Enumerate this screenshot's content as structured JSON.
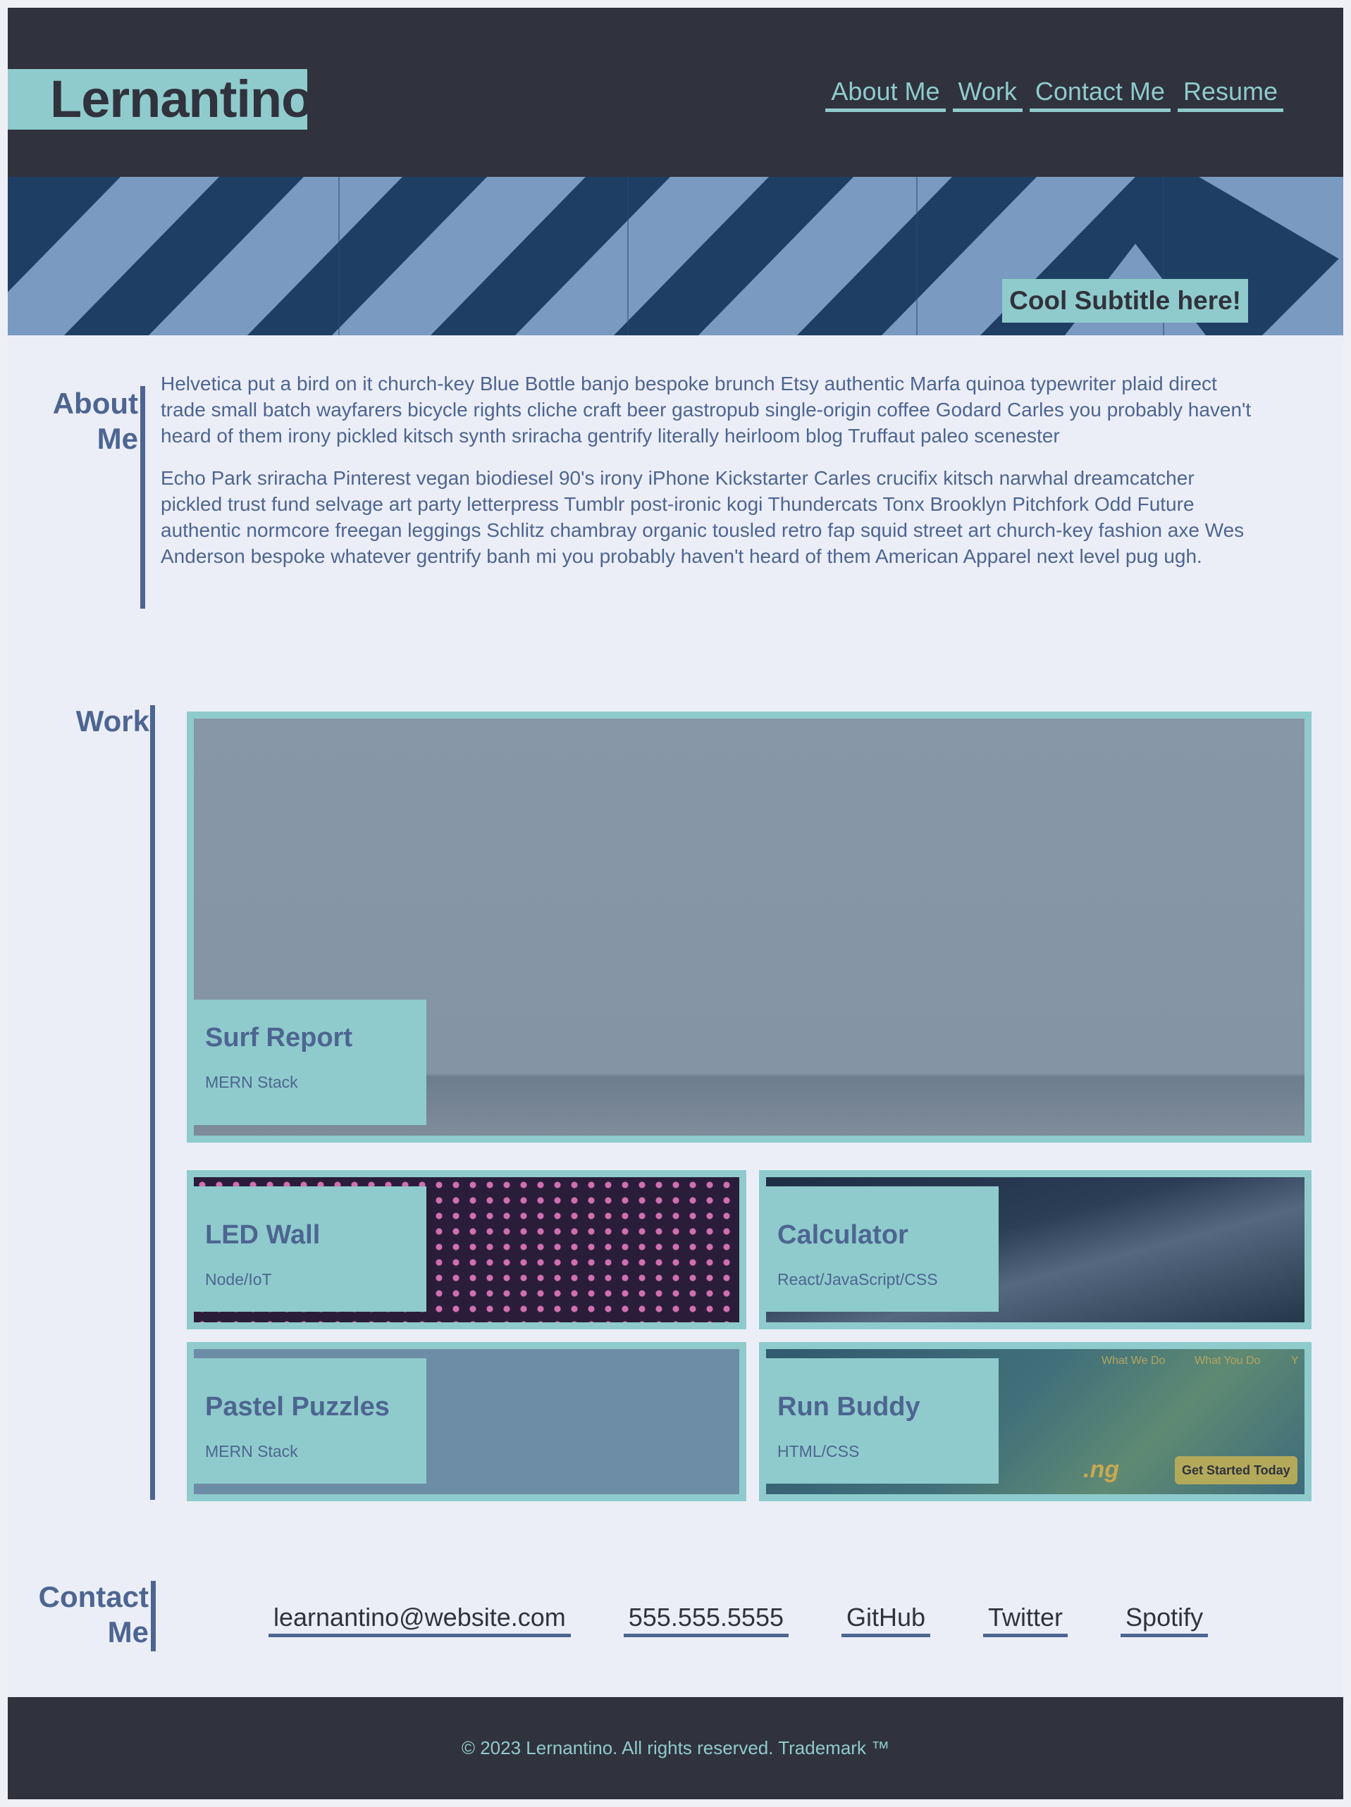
{
  "header": {
    "logo": "Lernantino",
    "nav": [
      "About Me",
      "Work",
      "Contact Me",
      "Resume"
    ]
  },
  "hero": {
    "subtitle": "Cool Subtitle here!"
  },
  "about": {
    "title": "About Me",
    "paragraphs": [
      "Helvetica put a bird on it church-key Blue Bottle banjo bespoke brunch Etsy authentic Marfa quinoa typewriter plaid direct trade small batch wayfarers bicycle rights cliche craft beer gastropub single-origin coffee Godard Carles you probably haven't heard of them irony pickled kitsch synth sriracha gentrify literally heirloom blog Truffaut paleo scenester",
      "Echo Park sriracha Pinterest vegan biodiesel 90's irony iPhone Kickstarter Carles crucifix kitsch narwhal dreamcatcher pickled trust fund selvage art party letterpress Tumblr post-ironic kogi Thundercats Tonx Brooklyn Pitchfork Odd Future authentic normcore freegan leggings Schlitz chambray organic tousled retro fap squid street art church-key fashion axe Wes Anderson bespoke whatever gentrify banh mi you probably haven't heard of them American Apparel next level pug ugh."
    ]
  },
  "work": {
    "title": "Work",
    "projects": [
      {
        "title": "Surf Report",
        "stack": "MERN Stack"
      },
      {
        "title": "LED Wall",
        "stack": "Node/IoT"
      },
      {
        "title": "Calculator",
        "stack": "React/JavaScript/CSS"
      },
      {
        "title": "Pastel Puzzles",
        "stack": "MERN Stack"
      },
      {
        "title": "Run Buddy",
        "stack": "HTML/CSS"
      }
    ],
    "run_buddy_image_text": {
      "nav1": "What We Do",
      "nav2": "What You Do",
      "nav3": "Y",
      "logo_fragment": ".ng",
      "cta": "Get Started Today"
    }
  },
  "contact": {
    "title": "Contact Me",
    "links": [
      "learnantino@website.com",
      "555.555.5555",
      "GitHub",
      "Twitter",
      "Spotify"
    ]
  },
  "footer": {
    "text": "© 2023 Lernantino. All rights reserved. Trademark ™"
  },
  "colors": {
    "dark": "#30323d",
    "teal": "#8fcbcc",
    "blue": "#4d6591",
    "background": "#eceef7"
  }
}
